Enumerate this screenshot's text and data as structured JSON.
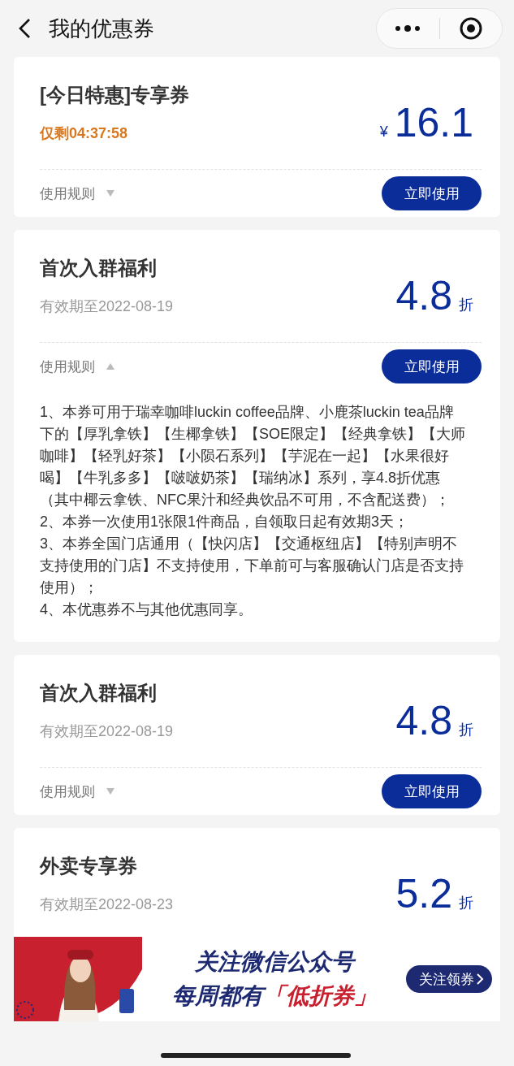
{
  "header": {
    "title": "我的优惠券"
  },
  "coupons": [
    {
      "title": "[今日特惠]专享券",
      "subtitle": {
        "kind": "countdown",
        "text": "仅剩04:37:58"
      },
      "price": {
        "kind": "amount",
        "currency": "¥",
        "value": "16.1"
      },
      "rules_label": "使用规则",
      "expanded": false,
      "button": "立即使用"
    },
    {
      "title": "首次入群福利",
      "subtitle": {
        "kind": "expiry",
        "text": "有效期至2022-08-19"
      },
      "price": {
        "kind": "discount",
        "value": "4.8",
        "unit": "折"
      },
      "rules_label": "使用规则",
      "expanded": true,
      "button": "立即使用",
      "rules": [
        "1、本券可用于瑞幸咖啡luckin coffee品牌、小鹿茶luckin tea品牌下的【厚乳拿铁】【生椰拿铁】【SOE限定】【经典拿铁】【大师咖啡】【轻乳好茶】【小陨石系列】【芋泥在一起】【水果很好喝】【牛乳多多】【啵啵奶茶】【瑞纳冰】系列，享4.8折优惠（其中椰云拿铁、NFC果汁和经典饮品不可用，不含配送费）；",
        "2、本券一次使用1张限1件商品，自领取日起有效期3天；",
        "3、本券全国门店通用（【快闪店】【交通枢纽店】【特别声明不支持使用的门店】不支持使用，下单前可与客服确认门店是否支持使用）；",
        "4、本优惠券不与其他优惠同享。"
      ]
    },
    {
      "title": "首次入群福利",
      "subtitle": {
        "kind": "expiry",
        "text": "有效期至2022-08-19"
      },
      "price": {
        "kind": "discount",
        "value": "4.8",
        "unit": "折"
      },
      "rules_label": "使用规则",
      "expanded": false,
      "button": "立即使用"
    },
    {
      "title": "外卖专享券",
      "subtitle": {
        "kind": "expiry",
        "text": "有效期至2022-08-23"
      },
      "price": {
        "kind": "discount",
        "value": "5.2",
        "unit": "折"
      }
    }
  ],
  "banner": {
    "line1": "关注微信公众号",
    "line2": "每周都有",
    "highlight": "「低折券」",
    "button": "关注领券"
  }
}
